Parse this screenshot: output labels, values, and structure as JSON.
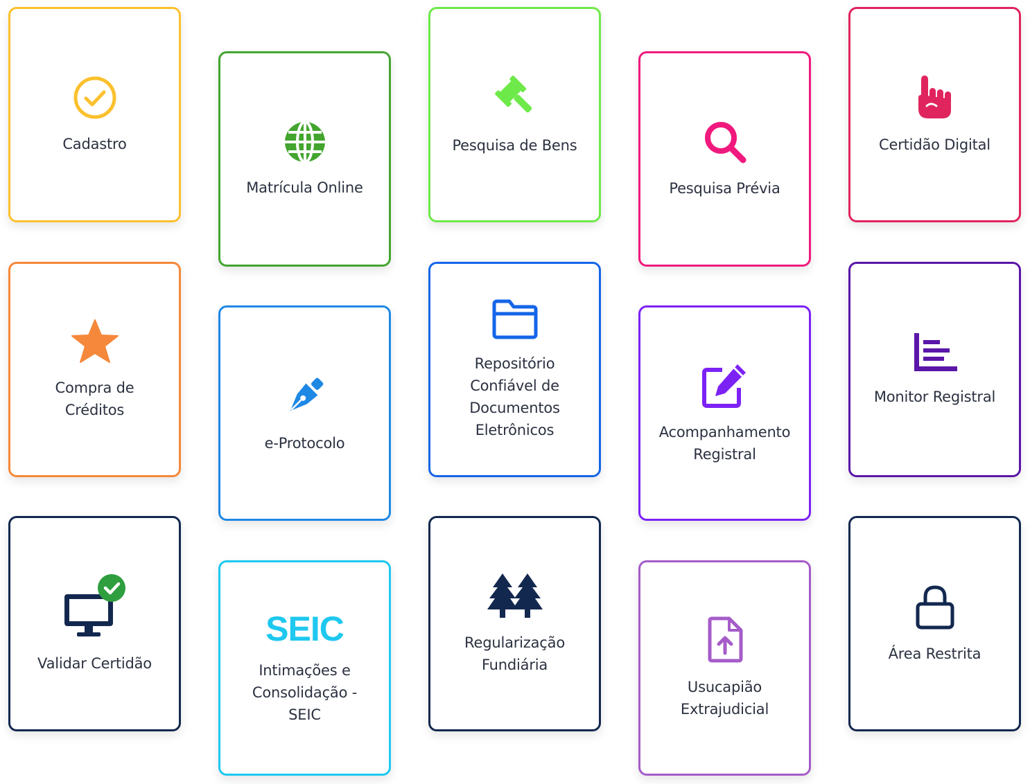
{
  "cards": [
    {
      "id": "cadastro",
      "label": "Cadastro",
      "icon": "check-circle-icon",
      "color": "#FBC02D"
    },
    {
      "id": "matricula-online",
      "label": "Matrícula Online",
      "icon": "globe-icon",
      "color": "#43A52F"
    },
    {
      "id": "pesquisa-de-bens",
      "label": "Pesquisa de Bens",
      "icon": "gavel-icon",
      "color": "#6EE94A"
    },
    {
      "id": "pesquisa-previa",
      "label": "Pesquisa Prévia",
      "icon": "search-icon",
      "color": "#F0197D"
    },
    {
      "id": "certidao-digital",
      "label": "Certidão Digital",
      "icon": "hand-pointing-icon",
      "color": "#E0245E"
    },
    {
      "id": "compra-de-creditos",
      "label": "Compra de\nCréditos",
      "icon": "star-icon",
      "color": "#F5883A"
    },
    {
      "id": "e-protocolo",
      "label": "e-Protocolo",
      "icon": "pen-nib-icon",
      "color": "#1E88E5"
    },
    {
      "id": "repositorio",
      "label": "Repositório\nConfiável de\nDocumentos\nEletrônicos",
      "icon": "folder-icon",
      "color": "#1565E8"
    },
    {
      "id": "acompanhamento-registral",
      "label": "Acompanhamento\nRegistral",
      "icon": "edit-icon",
      "color": "#7C22F5"
    },
    {
      "id": "monitor-registral",
      "label": "Monitor Registral",
      "icon": "bar-list-icon",
      "color": "#5A16A8"
    },
    {
      "id": "validar-certidao",
      "label": "Validar Certidão",
      "icon": "monitor-check-icon",
      "color": "#13284F"
    },
    {
      "id": "seic",
      "label": "Intimações e\nConsolidação -\nSEIC",
      "logo": "SEIC",
      "icon": "seic-logo",
      "color": "#1EC8EF"
    },
    {
      "id": "regularizacao-fundiaria",
      "label": "Regularização\nFundiária",
      "icon": "trees-icon",
      "color": "#13284F"
    },
    {
      "id": "usucapiao-extrajudicial",
      "label": "Usucapião\nExtrajudicial",
      "icon": "file-upload-icon",
      "color": "#A55CC8"
    },
    {
      "id": "area-restrita",
      "label": "Área Restrita",
      "icon": "lock-icon",
      "color": "#13284F"
    }
  ]
}
